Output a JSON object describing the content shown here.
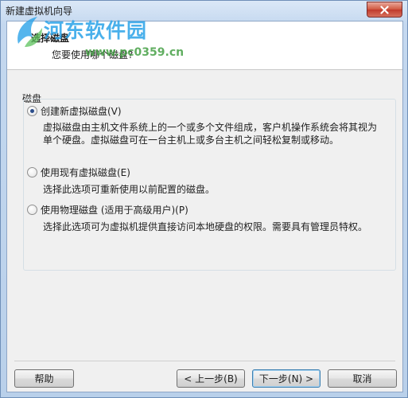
{
  "window": {
    "title": "新建虚拟机向导"
  },
  "watermark": {
    "site_name": "河东软件园",
    "url": "www.pc0359.cn"
  },
  "header": {
    "title": "选择磁盘",
    "subtitle": "您要使用哪个磁盘?"
  },
  "group": {
    "label": "磁盘",
    "options": [
      {
        "label": "创建新虚拟磁盘(V)",
        "selected": true,
        "description": [
          "虚拟磁盘由主机文件系统上的一个或多个文件组成，客户机操作系统会将其视为",
          "单个硬盘。虚拟磁盘可在一台主机上或多台主机之间轻松复制或移动。"
        ]
      },
      {
        "label": "使用现有虚拟磁盘(E)",
        "selected": false,
        "description": [
          "选择此选项可重新使用以前配置的磁盘。"
        ]
      },
      {
        "label": "使用物理磁盘 (适用于高级用户)(P)",
        "selected": false,
        "description": [
          "选择此选项可为虚拟机提供直接访问本地硬盘的权限。需要具有管理员特权。"
        ]
      }
    ]
  },
  "buttons": {
    "help": "帮助",
    "back": "< 上一步(B)",
    "next": "下一步(N) >",
    "cancel": "取消"
  }
}
